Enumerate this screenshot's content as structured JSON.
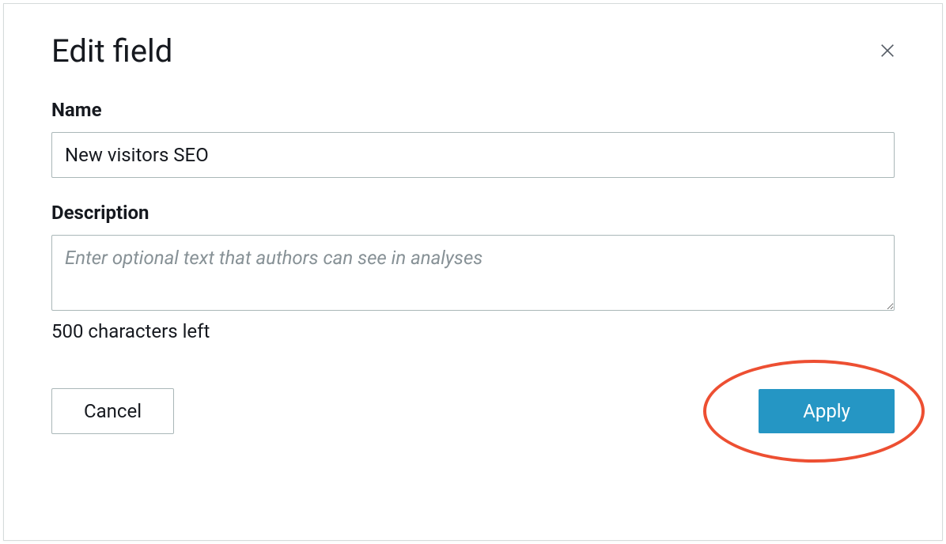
{
  "dialog": {
    "title": "Edit field",
    "name": {
      "label": "Name",
      "value": "New visitors SEO"
    },
    "description": {
      "label": "Description",
      "placeholder": "Enter optional text that authors can see in analyses",
      "value": "",
      "helper": "500 characters left"
    },
    "buttons": {
      "cancel": "Cancel",
      "apply": "Apply"
    }
  }
}
